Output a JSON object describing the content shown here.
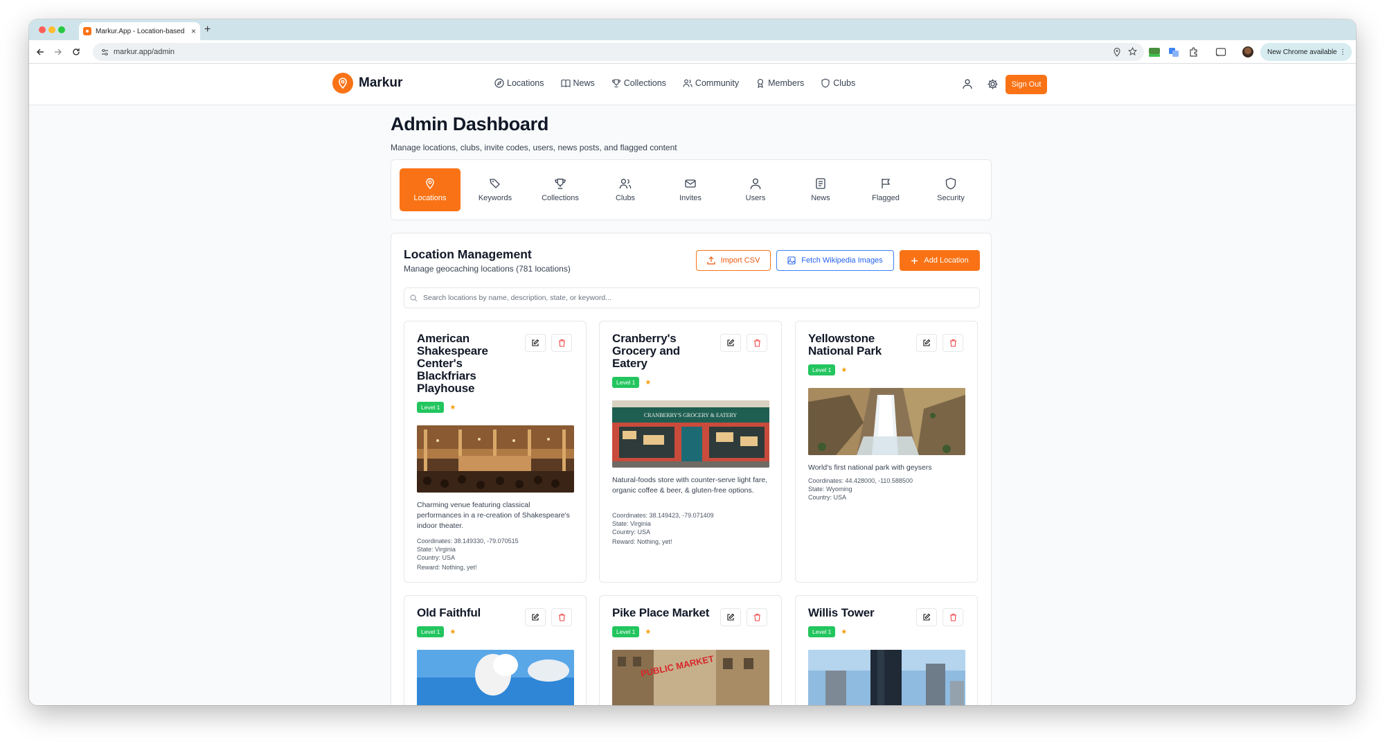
{
  "browser": {
    "tab_title": "Markur.App - Location-based",
    "url": "markur.app/admin",
    "update_label": "New Chrome available"
  },
  "site": {
    "brand": "Markur",
    "nav": [
      {
        "label": "Locations",
        "icon": "compass-icon"
      },
      {
        "label": "News",
        "icon": "book-icon"
      },
      {
        "label": "Collections",
        "icon": "trophy-icon"
      },
      {
        "label": "Community",
        "icon": "users-icon"
      },
      {
        "label": "Members",
        "icon": "award-icon"
      },
      {
        "label": "Clubs",
        "icon": "shield-icon"
      }
    ],
    "sign_out": "Sign Out",
    "accent": "#f97316"
  },
  "dashboard": {
    "title": "Admin Dashboard",
    "subtitle": "Manage locations, clubs, invite codes, users, news posts, and flagged content",
    "tabs": [
      {
        "label": "Locations",
        "icon": "map-pin-icon",
        "active": true
      },
      {
        "label": "Keywords",
        "icon": "tags-icon",
        "active": false
      },
      {
        "label": "Collections",
        "icon": "trophy-icon",
        "active": false
      },
      {
        "label": "Clubs",
        "icon": "users-icon",
        "active": false
      },
      {
        "label": "Invites",
        "icon": "mail-icon",
        "active": false
      },
      {
        "label": "Users",
        "icon": "user-icon",
        "active": false
      },
      {
        "label": "News",
        "icon": "newspaper-icon",
        "active": false
      },
      {
        "label": "Flagged",
        "icon": "flag-icon",
        "active": false
      },
      {
        "label": "Security",
        "icon": "shield-icon",
        "active": false
      }
    ]
  },
  "management": {
    "title": "Location Management",
    "subtitle": "Manage geocaching locations (781 locations)",
    "import_label": "Import CSV",
    "wiki_label": "Fetch Wikipedia Images",
    "add_label": "Add Location",
    "search_placeholder": "Search locations by name, description, state, or keyword..."
  },
  "locations": [
    {
      "name": "American Shakespeare Center's Blackfriars Playhouse",
      "level": "Level 1",
      "description": "Charming venue featuring classical performances in a re-creation of Shakespeare's indoor theater.",
      "coordinates": "Coordinates: 38.149330, -79.070515",
      "state": "State: Virginia",
      "country": "Country: USA",
      "reward": "Reward: Nothing, yet!"
    },
    {
      "name": "Cranberry's Grocery and Eatery",
      "level": "Level 1",
      "sign_text": "CRANBERRY'S GROCERY & EATERY",
      "description": "Natural-foods store with counter-serve light fare, organic coffee & beer, & gluten-free options.",
      "coordinates": "Coordinates: 38.149423, -79.071409",
      "state": "State: Virginia",
      "country": "Country: USA",
      "reward": "Reward: Nothing, yet!"
    },
    {
      "name": "Yellowstone National Park",
      "level": "Level 1",
      "description": "World's first national park with geysers",
      "coordinates": "Coordinates: 44.428000, -110.588500",
      "state": "State: Wyoming",
      "country": "Country: USA"
    },
    {
      "name": "Old Faithful",
      "level": "Level 1"
    },
    {
      "name": "Pike Place Market",
      "level": "Level 1",
      "sign_text": "PUBLIC MARKET"
    },
    {
      "name": "Willis Tower",
      "level": "Level 1"
    }
  ]
}
